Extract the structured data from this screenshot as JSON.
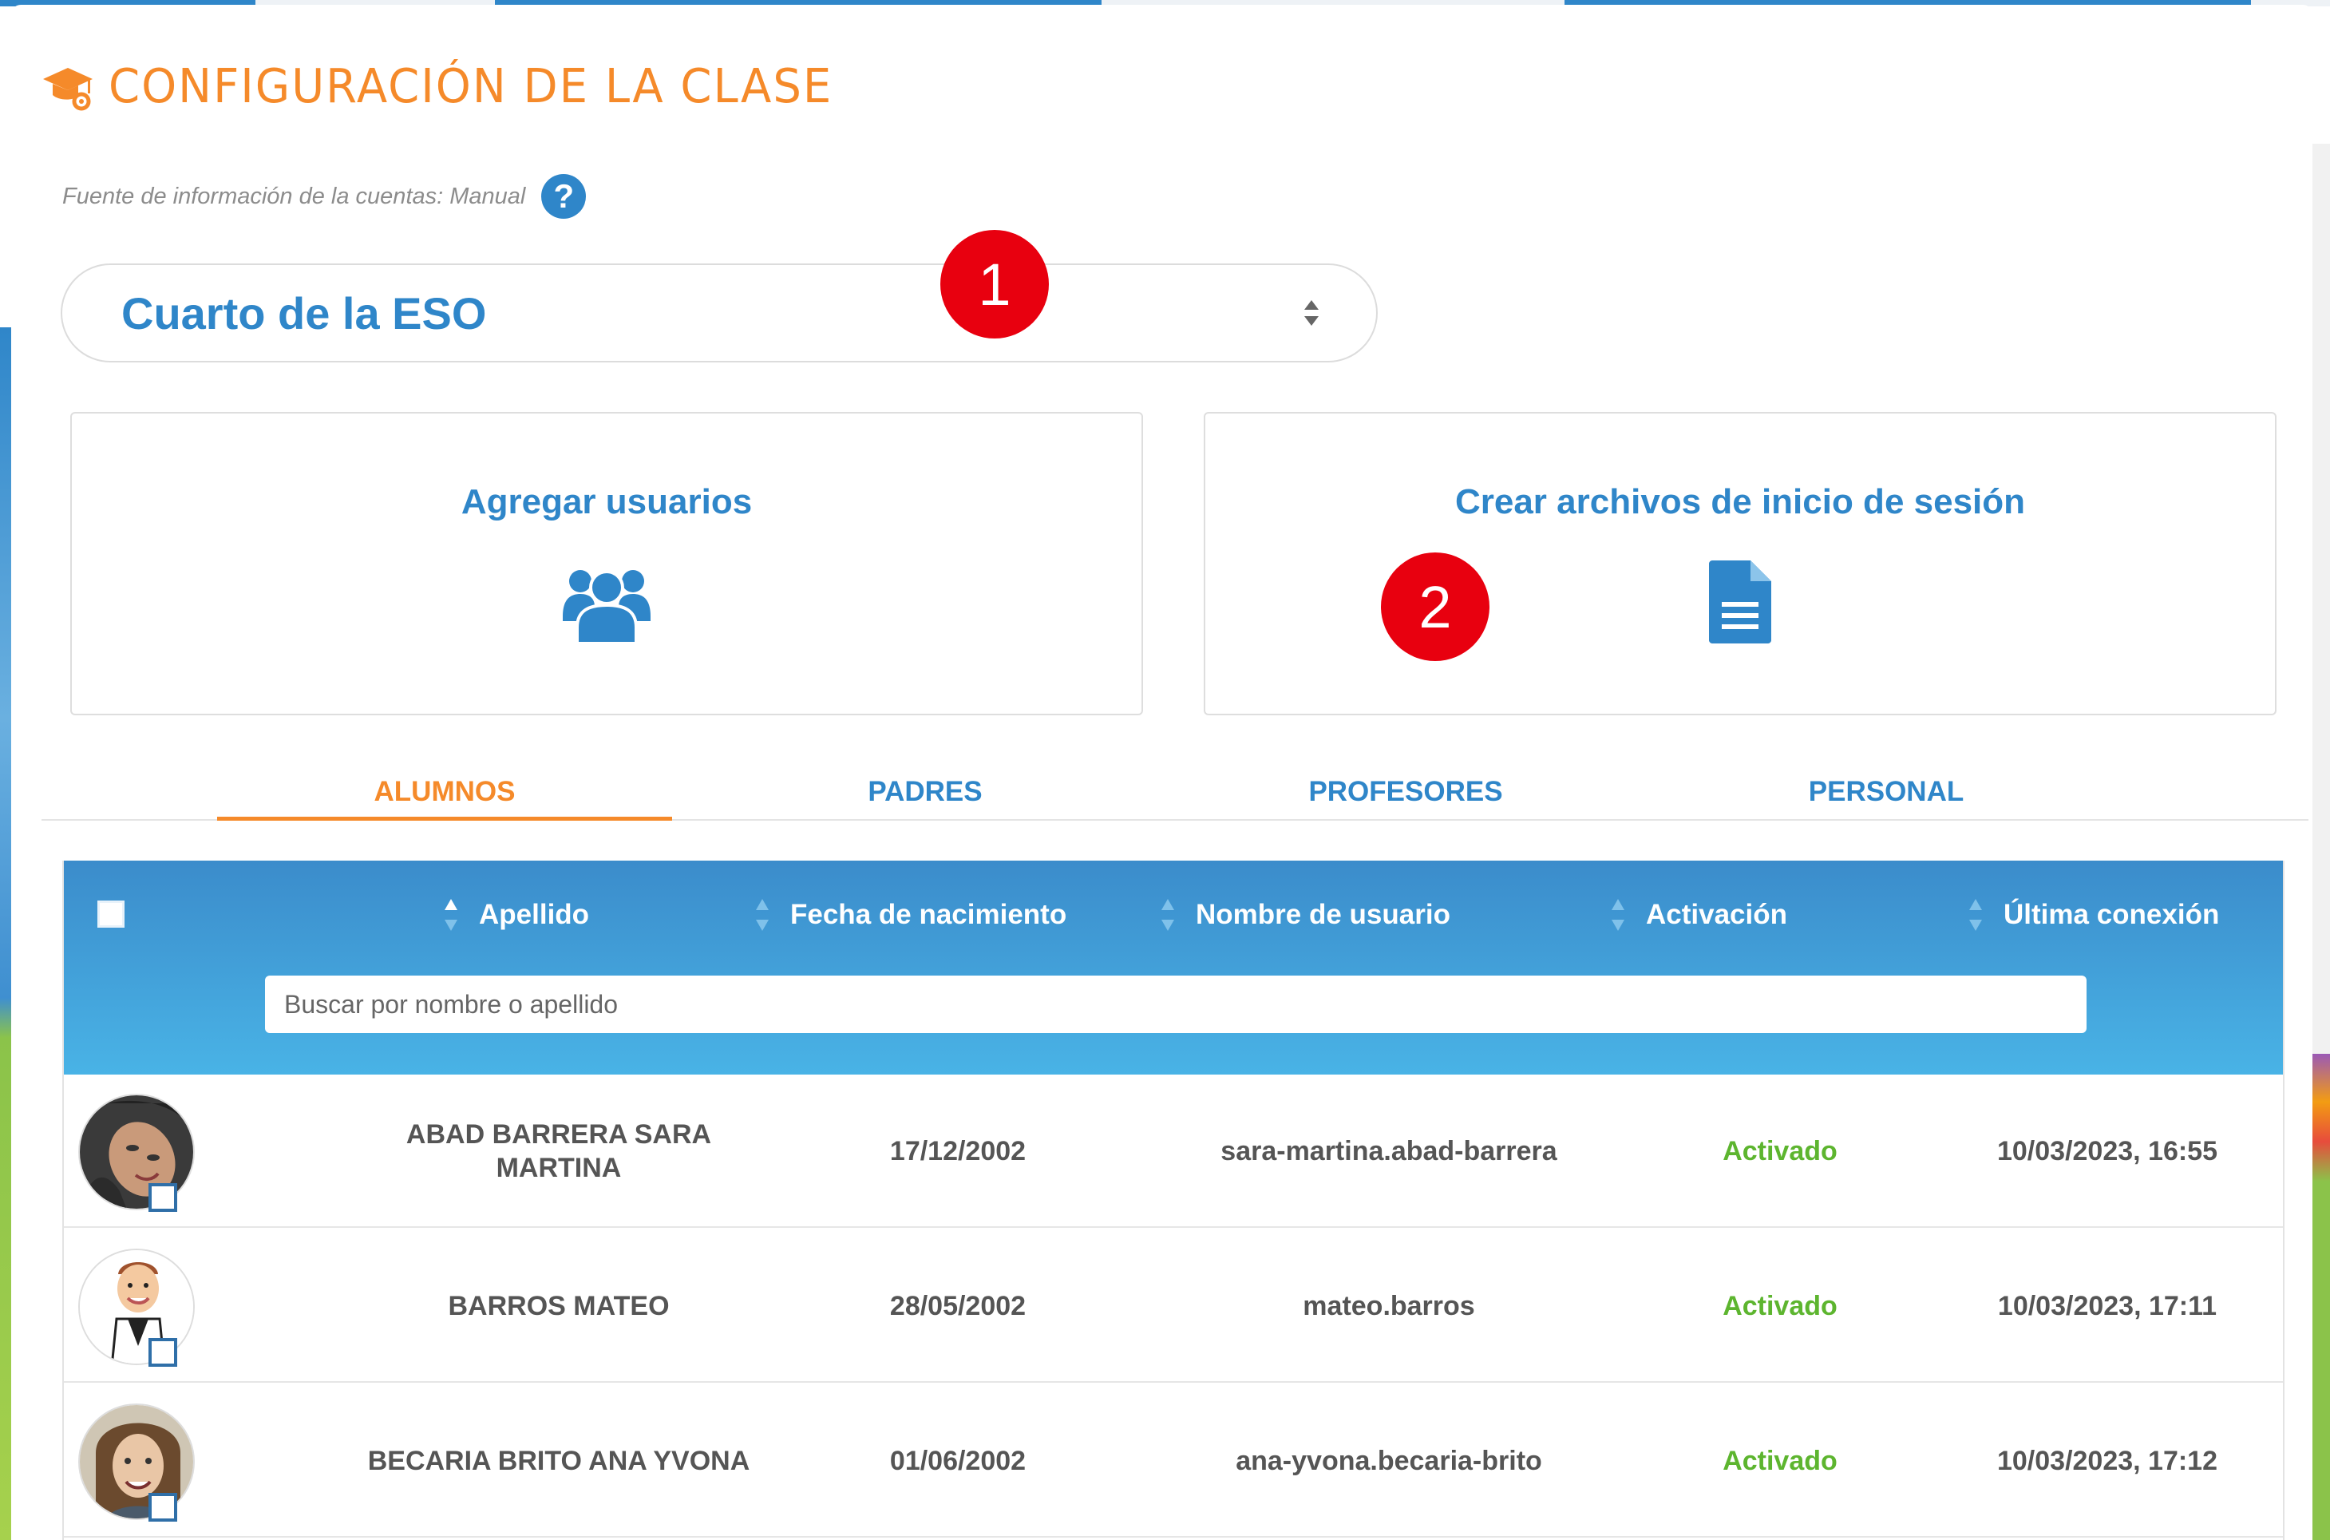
{
  "header": {
    "title": "CONFIGURACIÓN DE LA CLASE",
    "icon": "graduation-cap-gear-icon"
  },
  "source": {
    "text": "Fuente de información de la cuentas: Manual",
    "help_icon_label": "?"
  },
  "class_select": {
    "selected": "Cuarto de la ESO"
  },
  "badges": [
    "1",
    "2"
  ],
  "cards": {
    "add_users": {
      "label": "Agregar usuarios",
      "icon": "users-icon"
    },
    "create_login_files": {
      "label": "Crear archivos de inicio de sesión",
      "icon": "document-icon"
    }
  },
  "tabs": [
    {
      "label": "ALUMNOS",
      "active": true
    },
    {
      "label": "PADRES",
      "active": false
    },
    {
      "label": "PROFESORES",
      "active": false
    },
    {
      "label": "PERSONAL",
      "active": false
    }
  ],
  "table": {
    "columns": [
      "Apellido",
      "Fecha de nacimiento",
      "Nombre de usuario",
      "Activación",
      "Última conexión"
    ],
    "search_placeholder": "Buscar por nombre o apellido",
    "rows": [
      {
        "name": "ABAD BARRERA SARA MARTINA",
        "birth": "17/12/2002",
        "username": "sara-martina.abad-barrera",
        "activation": "Activado",
        "last": "10/03/2023, 16:55"
      },
      {
        "name": "BARROS MATEO",
        "birth": "28/05/2002",
        "username": "mateo.barros",
        "activation": "Activado",
        "last": "10/03/2023, 17:11"
      },
      {
        "name": "BECARIA BRITO ANA YVONA",
        "birth": "01/06/2002",
        "username": "ana-yvona.becaria-brito",
        "activation": "Activado",
        "last": "10/03/2023, 17:12"
      }
    ]
  },
  "colors": {
    "accent_orange": "#f58a2a",
    "primary_blue": "#2f86c9",
    "activated_green": "#5db52f",
    "badge_red": "#e8000f"
  }
}
